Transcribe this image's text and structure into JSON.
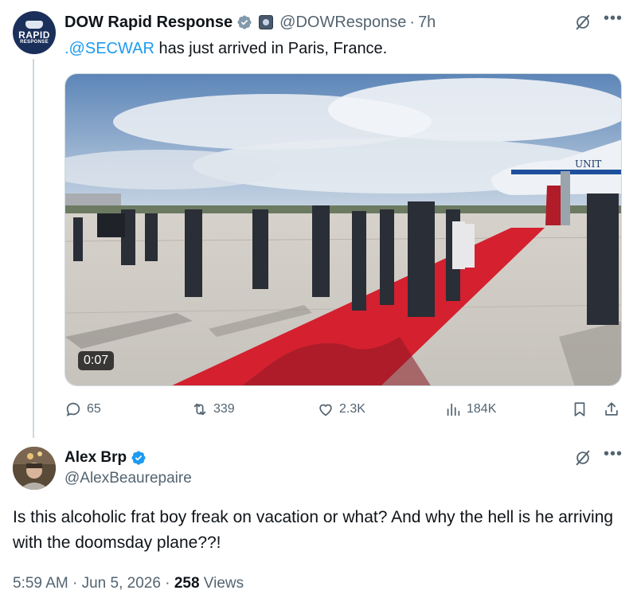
{
  "tweet": {
    "avatar": {
      "line1": "RAPID",
      "line2": "RESPONSE"
    },
    "author_name": "DOW Rapid Response",
    "handle": "@DOWResponse",
    "separator": "·",
    "time_ago": "7h",
    "text_mention": ".@SECWAR",
    "text_body": " has just arrived in Paris, France.",
    "video": {
      "duration": "0:07",
      "plane_lettering": "UNIT"
    },
    "stats": {
      "replies": "65",
      "reposts": "339",
      "likes": "2.3K",
      "views": "184K"
    },
    "icons": [
      "verified-icon",
      "gov-badge-icon",
      "grok-icon",
      "more-icon",
      "reply-icon",
      "repost-icon",
      "like-icon",
      "views-icon",
      "bookmark-icon",
      "share-icon"
    ]
  },
  "reply": {
    "author_name": "Alex Brp",
    "handle": "@AlexBeaurepaire",
    "text": "Is this alcoholic frat boy freak on vacation or what? And why the hell is he arriving with the doomsday plane??!",
    "time": "5:59 AM",
    "separator": "·",
    "date": "Jun 5, 2026",
    "separator2": "·",
    "views_count": "258",
    "views_label": "Views"
  },
  "colors": {
    "link": "#1d9bf0",
    "secondary_text": "#536471",
    "verified": "#1d9bf0",
    "carpet": "#d4202f"
  }
}
